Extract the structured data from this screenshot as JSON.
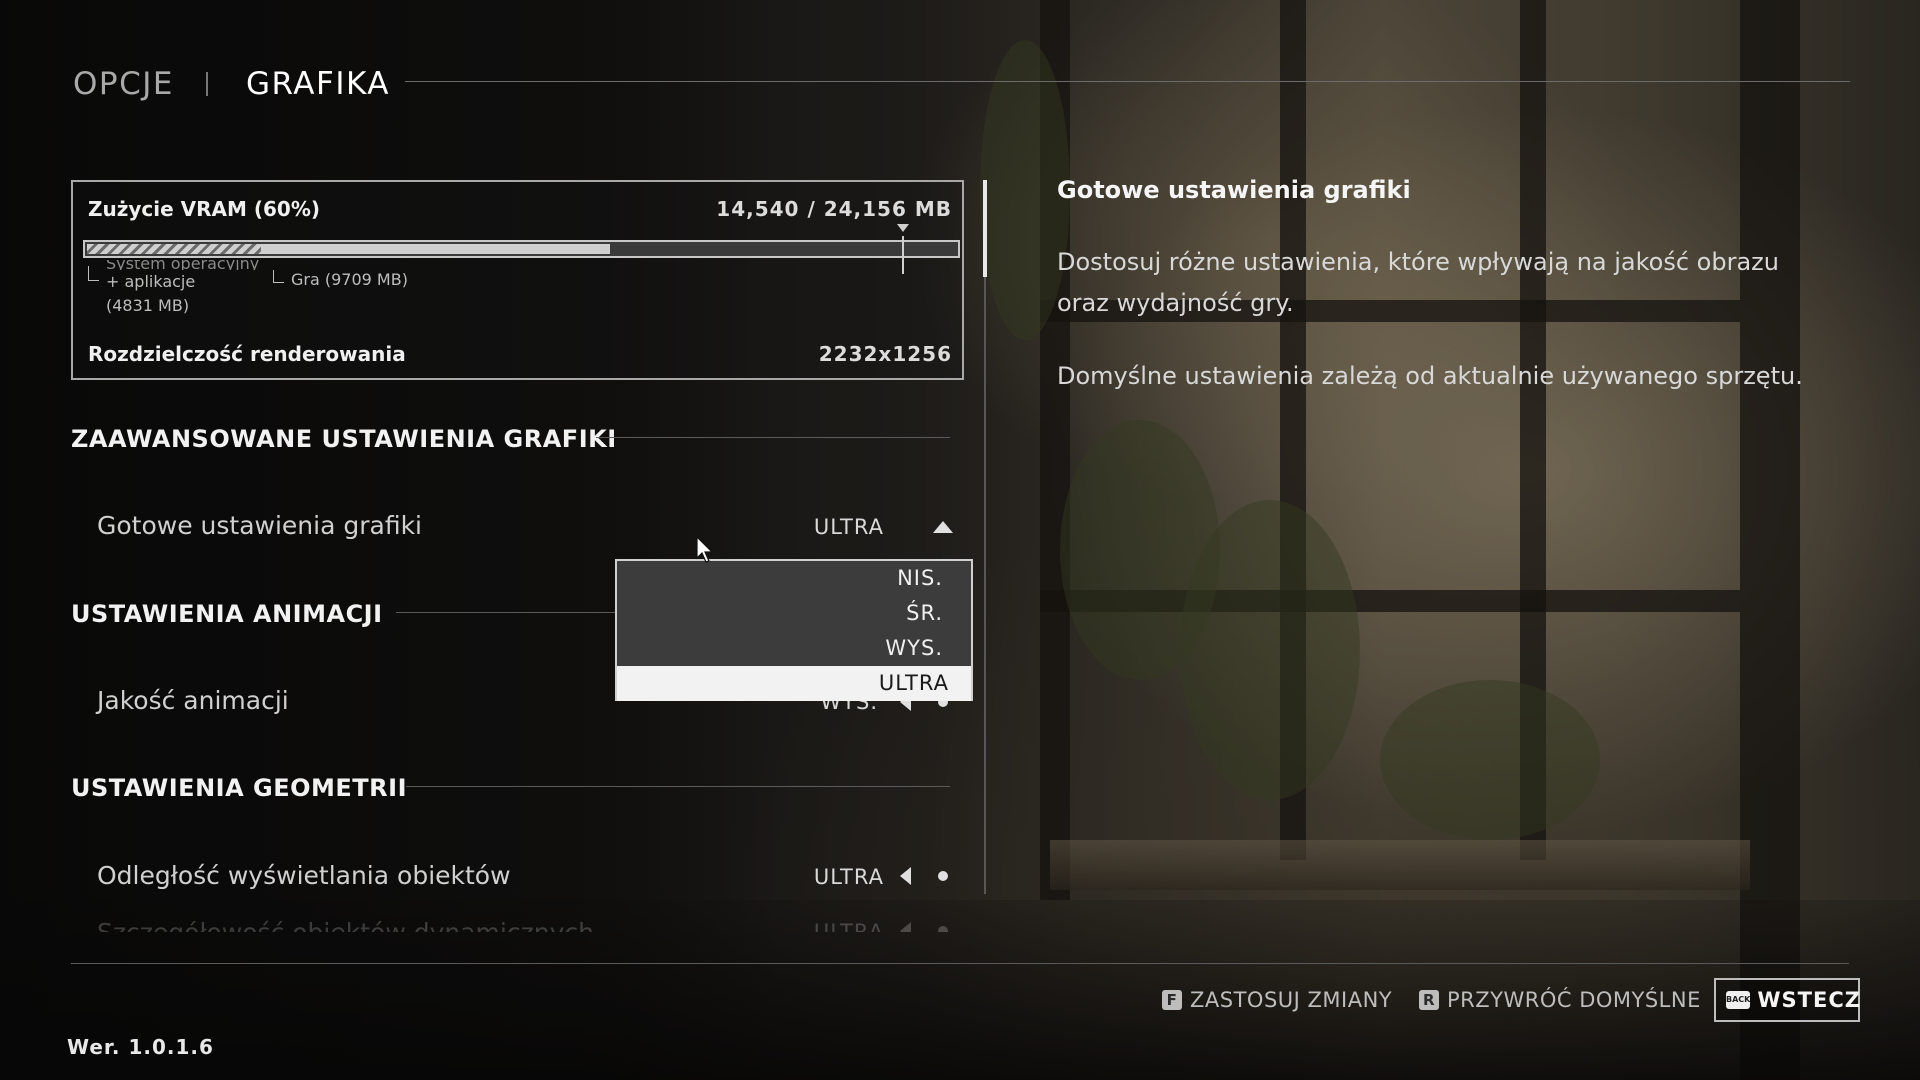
{
  "header": {
    "tab_options": "OPCJE",
    "tab_graphics": "GRAFIKA"
  },
  "vram": {
    "title": "Zużycie VRAM (60%)",
    "value": "14,540 / 24,156 MB",
    "usage_fraction": 0.6,
    "os_label_cut": "System operacyjny",
    "os_label_line2": "+ aplikacje",
    "os_label_line3": "(4831 MB)",
    "game_label": "Gra (9709 MB)",
    "render_label": "Rozdzielczość renderowania",
    "render_value": "2232x1256"
  },
  "sections": {
    "advanced": "ZAAWANSOWANE USTAWIENIA GRAFIKI",
    "animation": "USTAWIENIA ANIMACJI",
    "geometry": "USTAWIENIA GEOMETRII"
  },
  "rows": {
    "preset_label": "Gotowe ustawienia grafiki",
    "preset_value": "ULTRA",
    "anim_label": "Jakość animacji",
    "anim_value": "WYS.",
    "draw_distance_label": "Odległość wyświetlania obiektów",
    "draw_distance_value": "ULTRA",
    "dynamic_detail_label": "Szczegółowość obiektów dynamicznych",
    "dynamic_detail_value": "ULTRA"
  },
  "dropdown": {
    "options": [
      "NIS.",
      "ŚR.",
      "WYS.",
      "ULTRA"
    ],
    "selected": "ULTRA"
  },
  "info": {
    "title": "Gotowe ustawienia grafiki",
    "description": "Dostosuj różne ustawienia, które wpływają na jakość obrazu oraz wydajność gry.",
    "note": "Domyślne ustawienia zależą od aktualnie używanego sprzętu."
  },
  "footer": {
    "version": "Wer. 1.0.1.6",
    "apply_key": "F",
    "apply_label": "ZASTOSUJ ZMIANY",
    "reset_key": "R",
    "reset_label": "PRZYWRÓĆ DOMYŚLNE",
    "back_key": "BACK",
    "back_label": "WSTECZ"
  }
}
